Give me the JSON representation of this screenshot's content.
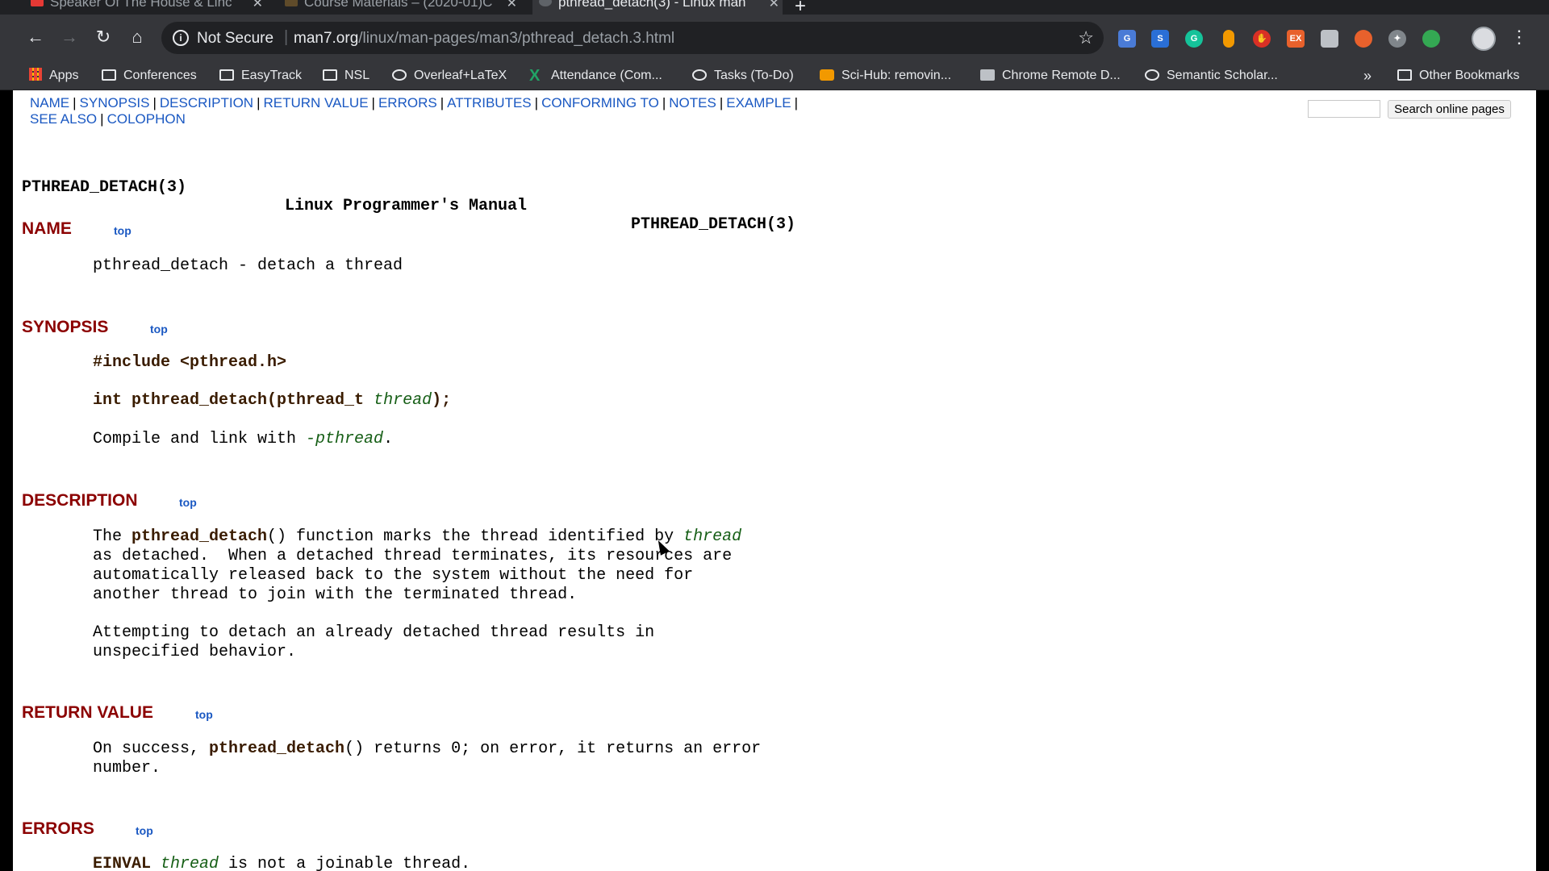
{
  "tabs": [
    {
      "title": "Speaker Of The House & Linc",
      "favicon_color": "#e53935",
      "active": false
    },
    {
      "title": "Course Materials – (2020-01)C",
      "favicon_color": "#5f4b2a",
      "active": false
    },
    {
      "title": "pthread_detach(3) - Linux man",
      "favicon_color": "#5f6368",
      "active": true
    }
  ],
  "toolbar": {
    "back_icon": "←",
    "forward_icon": "→",
    "reload_icon": "↻",
    "home_icon": "⌂",
    "security_status": "Not Secure",
    "url_host": "man7.org",
    "url_path": "/linux/man-pages/man3/pthread_detach.3.html",
    "star_icon": "☆",
    "menu_icon": "⋮"
  },
  "bookmarks": [
    {
      "label": "Apps",
      "icon": "apps-grid-icon"
    },
    {
      "label": "Conferences",
      "icon": "folder-icon"
    },
    {
      "label": "EasyTrack",
      "icon": "folder-icon"
    },
    {
      "label": "NSL",
      "icon": "folder-icon"
    },
    {
      "label": "Overleaf+LaTeX",
      "icon": "globe-icon"
    },
    {
      "label": "Attendance (Com...",
      "icon": "x-icon"
    },
    {
      "label": "Tasks (To-Do)",
      "icon": "globe-icon"
    },
    {
      "label": "Sci-Hub: removin...",
      "icon": "scihub-icon"
    },
    {
      "label": "Chrome Remote D...",
      "icon": "remote-icon"
    },
    {
      "label": "Semantic Scholar...",
      "icon": "globe-icon"
    },
    {
      "label": "Other Bookmarks",
      "icon": "folder-icon"
    }
  ],
  "bookmarks_more": "»",
  "page": {
    "nav": {
      "name": "NAME",
      "synopsis": "SYNOPSIS",
      "description": "DESCRIPTION",
      "return_value": "RETURN VALUE",
      "errors": "ERRORS",
      "attributes": "ATTRIBUTES",
      "conforming_to": "CONFORMING TO",
      "notes": "NOTES",
      "example": "EXAMPLE",
      "see_also": "SEE ALSO",
      "colophon": "COLOPHON",
      "separator": "|"
    },
    "search_button": "Search online pages",
    "header": {
      "left": "PTHREAD_DETACH(3)",
      "middle": "Linux Programmer's Manual",
      "right": "PTHREAD_DETACH(3)"
    },
    "top_link": "top",
    "sections": {
      "name": {
        "title": "NAME",
        "text": "pthread_detach - detach a thread"
      },
      "synopsis": {
        "title": "SYNOPSIS",
        "include": "#include <pthread.h>",
        "proto_type": "int pthread_detach(pthread_t ",
        "proto_arg": "thread",
        "proto_end": ");",
        "compile_pre": "Compile and link with ",
        "compile_flag": "-pthread",
        "compile_end": "."
      },
      "description": {
        "title": "DESCRIPTION",
        "p1_a": "The ",
        "p1_fn": "pthread_detach",
        "p1_b": "() function marks the thread identified by ",
        "p1_arg": "thread",
        "p1_rest": "as detached.  When a detached thread terminates, its resources are\nautomatically released back to the system without the need for\nanother thread to join with the terminated thread.",
        "p2": "Attempting to detach an already detached thread results in\nunspecified behavior."
      },
      "return_value": {
        "title": "RETURN VALUE",
        "a": "On success, ",
        "fn": "pthread_detach",
        "b": "() returns 0; on error, it returns an error\nnumber."
      },
      "errors": {
        "title": "ERRORS",
        "code": "EINVAL",
        "arg": "thread",
        "text": " is not a joinable thread."
      }
    }
  }
}
